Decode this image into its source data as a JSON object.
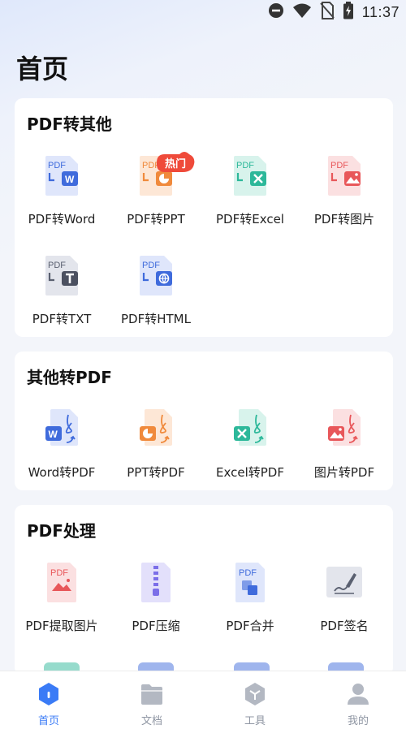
{
  "status_bar": {
    "time": "11:37",
    "icons": [
      "do-not-disturb-icon",
      "wifi-icon",
      "no-sim-icon",
      "battery-charging-icon"
    ]
  },
  "page": {
    "title": "首页"
  },
  "sections": [
    {
      "title": "PDF转其他",
      "items": [
        {
          "label": "PDF转Word",
          "icon": "pdf-to-word-icon",
          "accent": "#3f6bdc"
        },
        {
          "label": "PDF转PPT",
          "icon": "pdf-to-ppt-icon",
          "accent": "#f08a3c",
          "badge": "热门"
        },
        {
          "label": "PDF转Excel",
          "icon": "pdf-to-excel-icon",
          "accent": "#2db89a"
        },
        {
          "label": "PDF转图片",
          "icon": "pdf-to-image-icon",
          "accent": "#e8575a"
        },
        {
          "label": "PDF转TXT",
          "icon": "pdf-to-txt-icon",
          "accent": "#5a6070"
        },
        {
          "label": "PDF转HTML",
          "icon": "pdf-to-html-icon",
          "accent": "#3f6bdc"
        }
      ]
    },
    {
      "title": "其他转PDF",
      "items": [
        {
          "label": "Word转PDF",
          "icon": "word-to-pdf-icon",
          "accent": "#3f6bdc"
        },
        {
          "label": "PPT转PDF",
          "icon": "ppt-to-pdf-icon",
          "accent": "#f08a3c"
        },
        {
          "label": "Excel转PDF",
          "icon": "excel-to-pdf-icon",
          "accent": "#2db89a"
        },
        {
          "label": "图片转PDF",
          "icon": "image-to-pdf-icon",
          "accent": "#e8575a"
        }
      ]
    },
    {
      "title": "PDF处理",
      "items": [
        {
          "label": "PDF提取图片",
          "icon": "pdf-extract-image-icon",
          "accent": "#e8575a"
        },
        {
          "label": "PDF压缩",
          "icon": "pdf-compress-icon",
          "accent": "#7b6ee8"
        },
        {
          "label": "PDF合并",
          "icon": "pdf-merge-icon",
          "accent": "#3f6bdc"
        },
        {
          "label": "PDF签名",
          "icon": "pdf-sign-icon",
          "accent": "#5a6070"
        }
      ]
    }
  ],
  "tab_bar": {
    "active": 0,
    "tabs": [
      {
        "label": "首页",
        "icon": "home-icon"
      },
      {
        "label": "文档",
        "icon": "folder-icon"
      },
      {
        "label": "工具",
        "icon": "toolbox-icon"
      },
      {
        "label": "我的",
        "icon": "profile-icon"
      }
    ]
  },
  "colors": {
    "active": "#3a7bf6",
    "inactive": "#b3b8c2",
    "background": "#f3f5fa"
  }
}
